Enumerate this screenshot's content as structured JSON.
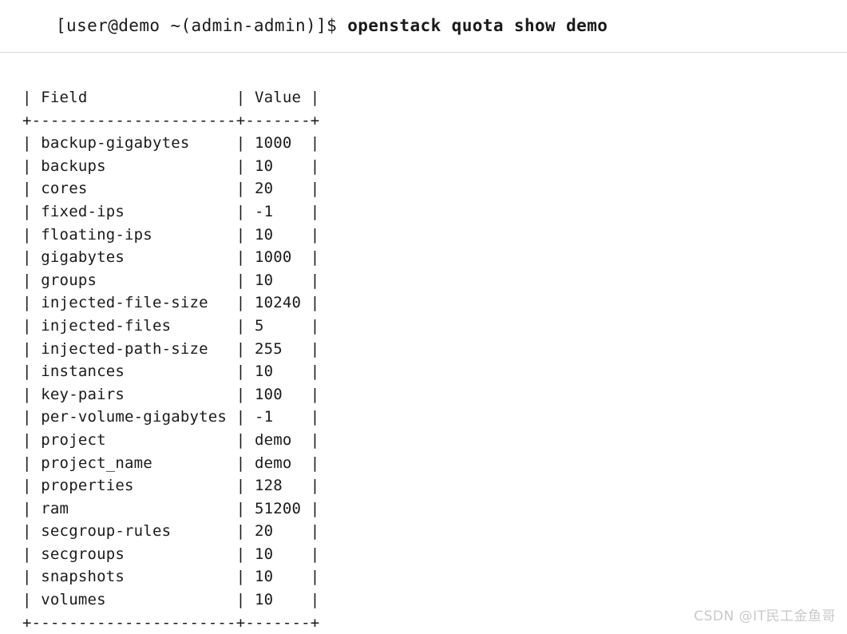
{
  "terminal": {
    "prompt": "[user@demo ~(admin-admin)]$ ",
    "command": "openstack quota show demo",
    "table": {
      "columns": [
        "Field",
        "Value"
      ],
      "field_col_width": 22,
      "value_col_width": 7,
      "border_char": "+",
      "dash_char": "-",
      "pipe_char": "|",
      "rows": [
        {
          "field": "backup-gigabytes",
          "value": "1000"
        },
        {
          "field": "backups",
          "value": "10"
        },
        {
          "field": "cores",
          "value": "20"
        },
        {
          "field": "fixed-ips",
          "value": "-1"
        },
        {
          "field": "floating-ips",
          "value": "10"
        },
        {
          "field": "gigabytes",
          "value": "1000"
        },
        {
          "field": "groups",
          "value": "10"
        },
        {
          "field": "injected-file-size",
          "value": "10240"
        },
        {
          "field": "injected-files",
          "value": "5"
        },
        {
          "field": "injected-path-size",
          "value": "255"
        },
        {
          "field": "instances",
          "value": "10"
        },
        {
          "field": "key-pairs",
          "value": "100"
        },
        {
          "field": "per-volume-gigabytes",
          "value": "-1"
        },
        {
          "field": "project",
          "value": "demo"
        },
        {
          "field": "project_name",
          "value": "demo"
        },
        {
          "field": "properties",
          "value": "128"
        },
        {
          "field": "ram",
          "value": "51200"
        },
        {
          "field": "secgroup-rules",
          "value": "20"
        },
        {
          "field": "secgroups",
          "value": "10"
        },
        {
          "field": "snapshots",
          "value": "10"
        },
        {
          "field": "volumes",
          "value": "10"
        }
      ]
    }
  },
  "watermark": {
    "text": "CSDN @IT民工金鱼哥"
  }
}
